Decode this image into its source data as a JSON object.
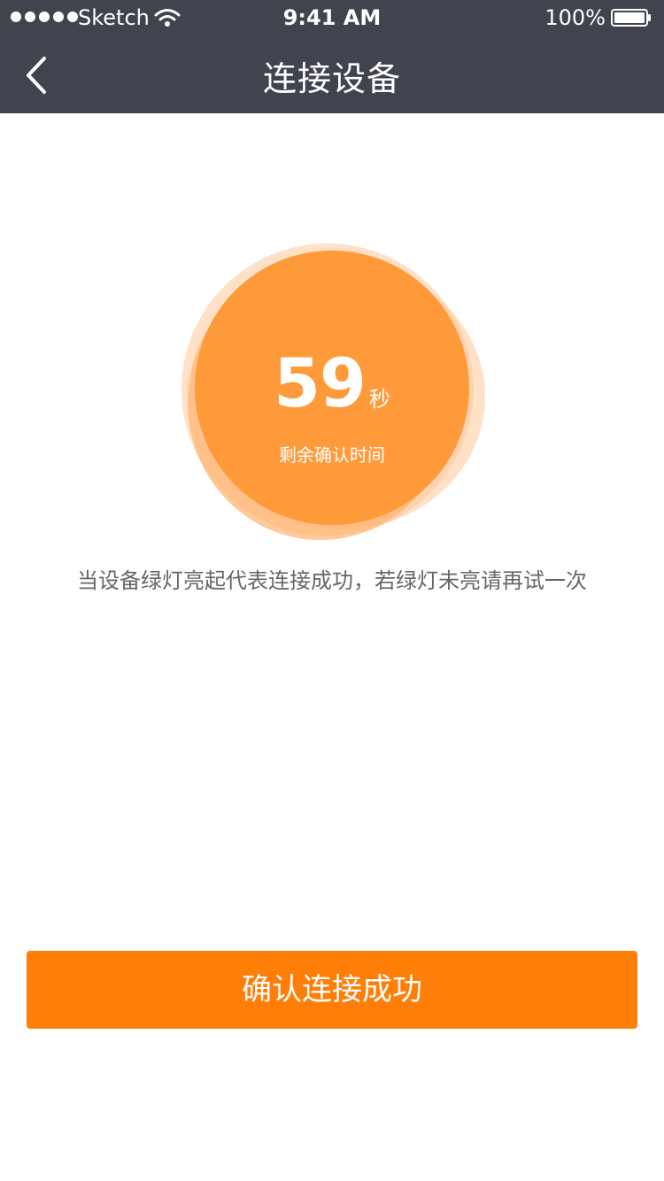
{
  "status_bar": {
    "carrier": "Sketch",
    "time": "9:41 AM",
    "battery": "100%"
  },
  "nav": {
    "title": "连接设备",
    "back_icon": "chevron-left-icon"
  },
  "countdown": {
    "value": "59",
    "unit": "秒",
    "label": "剩余确认时间"
  },
  "hint": "当设备绿灯亮起代表连接成功，若绿灯未亮请再试一次",
  "confirm_button": "确认连接成功",
  "colors": {
    "header_bg": "#41434f",
    "accent": "#ff7e07",
    "circle": "#ff9a3a",
    "circle_light": "#ffc89a",
    "hint_text": "#666666"
  }
}
